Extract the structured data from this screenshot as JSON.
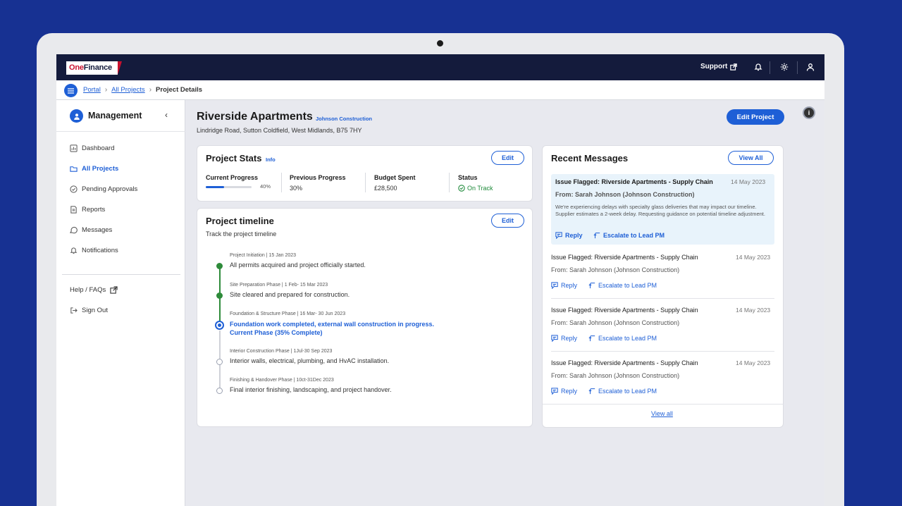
{
  "brand": {
    "logo_one": "One",
    "logo_finance": "Finance"
  },
  "topbar": {
    "support_label": "Support"
  },
  "breadcrumb": {
    "items": [
      "Portal",
      "All Projects"
    ],
    "current": "Project Details"
  },
  "sidebar": {
    "title": "Management",
    "items": [
      {
        "label": "Dashboard",
        "icon": "dashboard-icon"
      },
      {
        "label": "All Projects",
        "icon": "folder-icon",
        "active": true
      },
      {
        "label": "Pending Approvals",
        "icon": "check-circle-icon"
      },
      {
        "label": "Reports",
        "icon": "report-icon"
      },
      {
        "label": "Messages",
        "icon": "messages-icon"
      },
      {
        "label": "Notifications",
        "icon": "bell-icon"
      }
    ],
    "footer": [
      {
        "label": "Help / FAQs",
        "icon": "external-link-icon"
      },
      {
        "label": "Sign Out",
        "icon": "sign-out-icon"
      }
    ]
  },
  "project": {
    "title": "Riverside Apartments",
    "contractor": "Johnson Construction",
    "address": "Lindridge Road, Sutton Coldfield, West Midlands, B75 7HY",
    "edit_label": "Edit Project"
  },
  "stats": {
    "title": "Project Stats",
    "info_label": "Info",
    "edit_label": "Edit",
    "current_progress_label": "Current Progress",
    "current_progress_value": "40%",
    "current_progress_fraction": 0.4,
    "previous_progress_label": "Previous Progress",
    "previous_progress_value": "30%",
    "budget_label": "Budget Spent",
    "budget_value": "£28,500",
    "status_label": "Status",
    "status_value": "On Track"
  },
  "timeline": {
    "title": "Project timeline",
    "subtitle": "Track the project timeline",
    "edit_label": "Edit",
    "phases": [
      {
        "phase": "Project Initiation | 15 Jan 2023",
        "desc": "All permits acquired and project officially started.",
        "state": "done"
      },
      {
        "phase": "Site Preparation Phase | 1 Feb- 15 Mar 2023",
        "desc": "Site cleared and prepared for construction.",
        "state": "done"
      },
      {
        "phase": "Foundation & Structure Phase | 16 Mar- 30 Jun 2023",
        "desc": "Foundation work completed, external wall construction in progress.",
        "desc2": "Current Phase (35% Complete)",
        "state": "current"
      },
      {
        "phase": "Interior Construction Phase | 1Jul-30 Sep 2023",
        "desc": "Interior walls, electrical, plumbing, and HvAC installation.",
        "state": "todo"
      },
      {
        "phase": "Finishing & Handover Phase | 10ct-31Dec 2023",
        "desc": "Final interior finishing, landscaping, and project handover.",
        "state": "todo"
      }
    ]
  },
  "messages": {
    "title": "Recent Messages",
    "view_all_label": "View All",
    "footer_link": "View all",
    "reply_label": "Reply",
    "escalate_label": "Escalate to Lead PM",
    "items": [
      {
        "subject": "Issue Flagged: Riverside Apartments - Supply Chain",
        "date": "14 May 2023",
        "from": "From: Sarah Johnson (Johnson Construction)",
        "body": "We're experiencing delays with specialty glass deliveries that may impact our timeline. Supplier estimates a 2-week delay. Requesting guidance on potential timeline adjustment."
      },
      {
        "subject": "Issue Flagged: Riverside Apartments - Supply Chain",
        "date": "14 May 2023",
        "from": "From: Sarah Johnson (Johnson Construction)"
      },
      {
        "subject": "Issue Flagged: Riverside Apartments - Supply Chain",
        "date": "14 May 2023",
        "from": "From: Sarah Johnson (Johnson Construction)"
      },
      {
        "subject": "Issue Flagged: Riverside Apartments - Supply Chain",
        "date": "14 May 2023",
        "from": "From: Sarah Johnson (Johnson Construction)"
      }
    ]
  },
  "colors": {
    "accent": "#1e5fd6",
    "navy": "#141b3c",
    "success": "#2e8b3a",
    "background": "#173192"
  }
}
